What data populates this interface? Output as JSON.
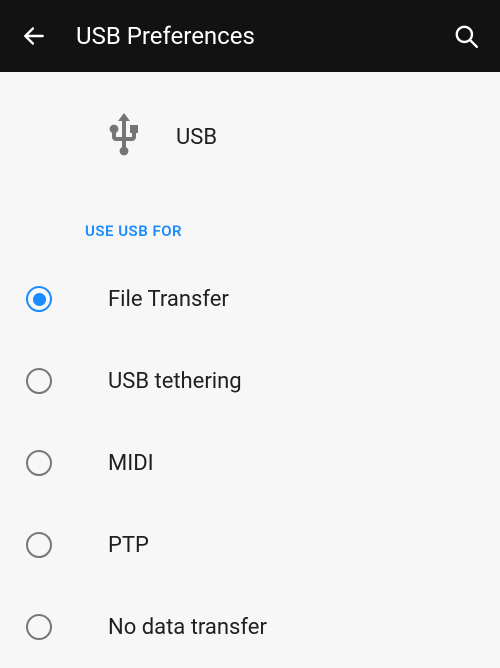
{
  "header": {
    "title": "USB Preferences"
  },
  "hero": {
    "label": "USB"
  },
  "section": {
    "label": "USE USB FOR"
  },
  "options": [
    {
      "label": "File Transfer",
      "selected": true
    },
    {
      "label": "USB tethering",
      "selected": false
    },
    {
      "label": "MIDI",
      "selected": false
    },
    {
      "label": "PTP",
      "selected": false
    },
    {
      "label": "No data transfer",
      "selected": false
    }
  ],
  "colors": {
    "accent": "#1a8cff",
    "header_bg": "#121212"
  }
}
